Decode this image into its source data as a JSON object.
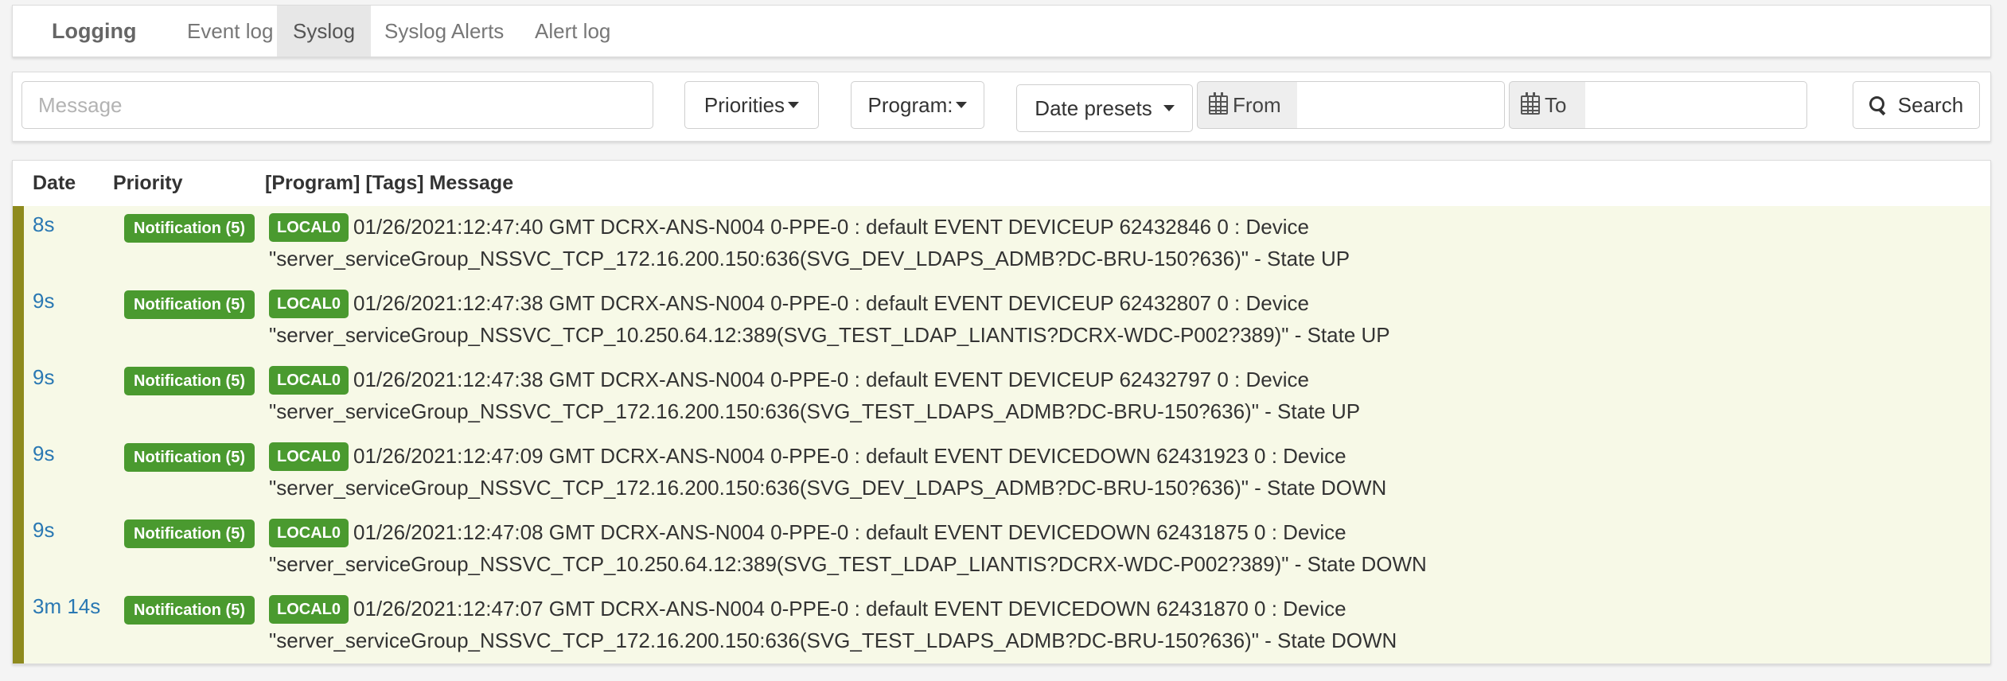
{
  "nav": {
    "brand": "Logging",
    "tabs": [
      {
        "label": "Event log"
      },
      {
        "label": "Syslog"
      },
      {
        "label": "Syslog Alerts"
      },
      {
        "label": "Alert log"
      }
    ]
  },
  "filters": {
    "message_placeholder": "Message",
    "priorities_label": "Priorities",
    "programs_label": "Program:",
    "date_presets_label": "Date presets",
    "from_label": "From",
    "to_label": "To",
    "search_label": "Search"
  },
  "table": {
    "columns": {
      "date": "Date",
      "priority": "Priority",
      "message": "[Program] [Tags] Message"
    },
    "rows": [
      {
        "date": "8s",
        "priority": "Notification (5)",
        "program": "LOCAL0",
        "line1": "01/26/2021:12:47:40 GMT DCRX-ANS-N004 0-PPE-0 : default EVENT DEVICEUP 62432846 0 : Device",
        "line2": "\"server_serviceGroup_NSSVC_TCP_172.16.200.150:636(SVG_DEV_LDAPS_ADMB?DC-BRU-150?636)\" - State UP"
      },
      {
        "date": "9s",
        "priority": "Notification (5)",
        "program": "LOCAL0",
        "line1": "01/26/2021:12:47:38 GMT DCRX-ANS-N004 0-PPE-0 : default EVENT DEVICEUP 62432807 0 : Device",
        "line2": "\"server_serviceGroup_NSSVC_TCP_10.250.64.12:389(SVG_TEST_LDAP_LIANTIS?DCRX-WDC-P002?389)\" - State UP"
      },
      {
        "date": "9s",
        "priority": "Notification (5)",
        "program": "LOCAL0",
        "line1": "01/26/2021:12:47:38 GMT DCRX-ANS-N004 0-PPE-0 : default EVENT DEVICEUP 62432797 0 : Device",
        "line2": "\"server_serviceGroup_NSSVC_TCP_172.16.200.150:636(SVG_TEST_LDAPS_ADMB?DC-BRU-150?636)\" - State UP"
      },
      {
        "date": "9s",
        "priority": "Notification (5)",
        "program": "LOCAL0",
        "line1": "01/26/2021:12:47:09 GMT DCRX-ANS-N004 0-PPE-0 : default EVENT DEVICEDOWN 62431923 0 : Device",
        "line2": "\"server_serviceGroup_NSSVC_TCP_172.16.200.150:636(SVG_DEV_LDAPS_ADMB?DC-BRU-150?636)\" - State DOWN"
      },
      {
        "date": "9s",
        "priority": "Notification (5)",
        "program": "LOCAL0",
        "line1": "01/26/2021:12:47:08 GMT DCRX-ANS-N004 0-PPE-0 : default EVENT DEVICEDOWN 62431875 0 : Device",
        "line2": "\"server_serviceGroup_NSSVC_TCP_10.250.64.12:389(SVG_TEST_LDAP_LIANTIS?DCRX-WDC-P002?389)\" - State DOWN"
      },
      {
        "date": "3m 14s",
        "priority": "Notification (5)",
        "program": "LOCAL0",
        "line1": "01/26/2021:12:47:07 GMT DCRX-ANS-N004 0-PPE-0 : default EVENT DEVICEDOWN 62431870 0 : Device",
        "line2": "\"server_serviceGroup_NSSVC_TCP_172.16.200.150:636(SVG_TEST_LDAPS_ADMB?DC-BRU-150?636)\" - State DOWN"
      }
    ]
  },
  "colors": {
    "row_background": "#f7f9e7",
    "row_marker": "#8e8a1d",
    "badge_green": "#4a9a2f",
    "date_link": "#2a78b3"
  }
}
